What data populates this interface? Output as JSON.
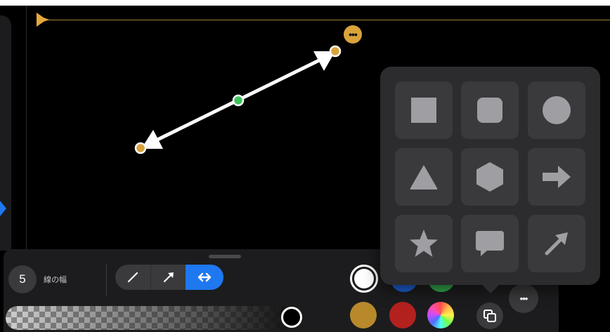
{
  "toolbar": {
    "line_width_value": "5",
    "line_width_label": "線の幅",
    "line_styles": [
      "line",
      "arrow",
      "double-arrow"
    ],
    "selected_line_style": "double-arrow",
    "opacity_percent": 100
  },
  "colors": {
    "selected": "#ffffff",
    "swatches": [
      "#ffffff",
      "#1e5fd6",
      "#34a84c",
      "#b8892b",
      "#b3211f",
      "multicolor"
    ],
    "accent": "#1e78f0",
    "handle": "#d9a33a"
  },
  "shapes_popover": {
    "items": [
      {
        "icon": "square-icon"
      },
      {
        "icon": "rounded-square-icon"
      },
      {
        "icon": "circle-icon"
      },
      {
        "icon": "triangle-icon"
      },
      {
        "icon": "hexagon-icon"
      },
      {
        "icon": "arrow-right-icon"
      },
      {
        "icon": "star-icon"
      },
      {
        "icon": "speech-bubble-icon"
      },
      {
        "icon": "diagonal-arrow-icon"
      }
    ]
  },
  "canvas": {
    "selected_object": "double-arrow-line"
  }
}
